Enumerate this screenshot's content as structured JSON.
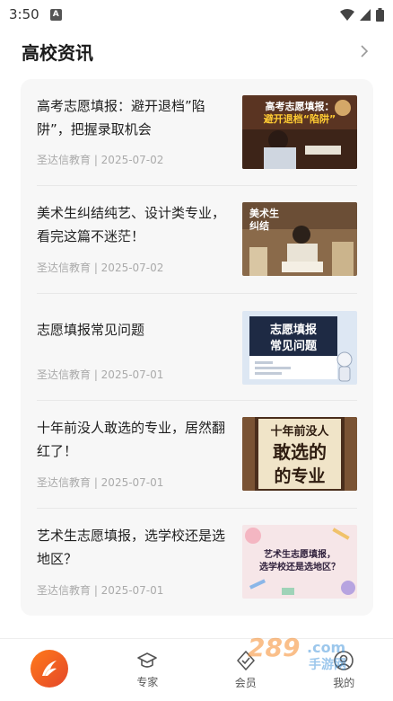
{
  "status_bar": {
    "time": "3:50",
    "app_icon": "A"
  },
  "header": {
    "title": "高校资讯"
  },
  "news": [
    {
      "title": "高考志愿填报：避开退档”陷阱”，把握录取机会",
      "meta": "圣达信教育 | 2025-07-02",
      "thumb_text": [
        "高考志愿填报：",
        "避开退档“陷阱”"
      ]
    },
    {
      "title": "美术生纠结纯艺、设计类专业，看完这篇不迷茫！",
      "meta": "圣达信教育 | 2025-07-02",
      "thumb_text": [
        "美术生",
        "纠结"
      ]
    },
    {
      "title": "志愿填报常见问题",
      "meta": "圣达信教育 | 2025-07-01",
      "thumb_text": [
        "志愿填报",
        "常见问题"
      ]
    },
    {
      "title": "十年前没人敢选的专业，居然翻红了！",
      "meta": "圣达信教育 | 2025-07-01",
      "thumb_text": [
        "十年前没人",
        "敢选的",
        "的专业"
      ]
    },
    {
      "title": "艺术生志愿填报，选学校还是选地区？",
      "meta": "圣达信教育 | 2025-07-01",
      "thumb_text": [
        "艺术生志愿填报，",
        "选学校还是选地区？"
      ]
    }
  ],
  "tabs": [
    {
      "label": "",
      "icon": "home-logo-icon"
    },
    {
      "label": "专家",
      "icon": "graduation-cap-icon"
    },
    {
      "label": "会员",
      "icon": "shield-icon"
    },
    {
      "label": "我的",
      "icon": "user-icon"
    }
  ],
  "watermark": {
    "brand": "289",
    "suffix": ".com",
    "sub": "手游网"
  },
  "colors": {
    "accent": "#f26b1f",
    "card_bg": "#f7f7f7",
    "meta": "#aaaaaa"
  }
}
